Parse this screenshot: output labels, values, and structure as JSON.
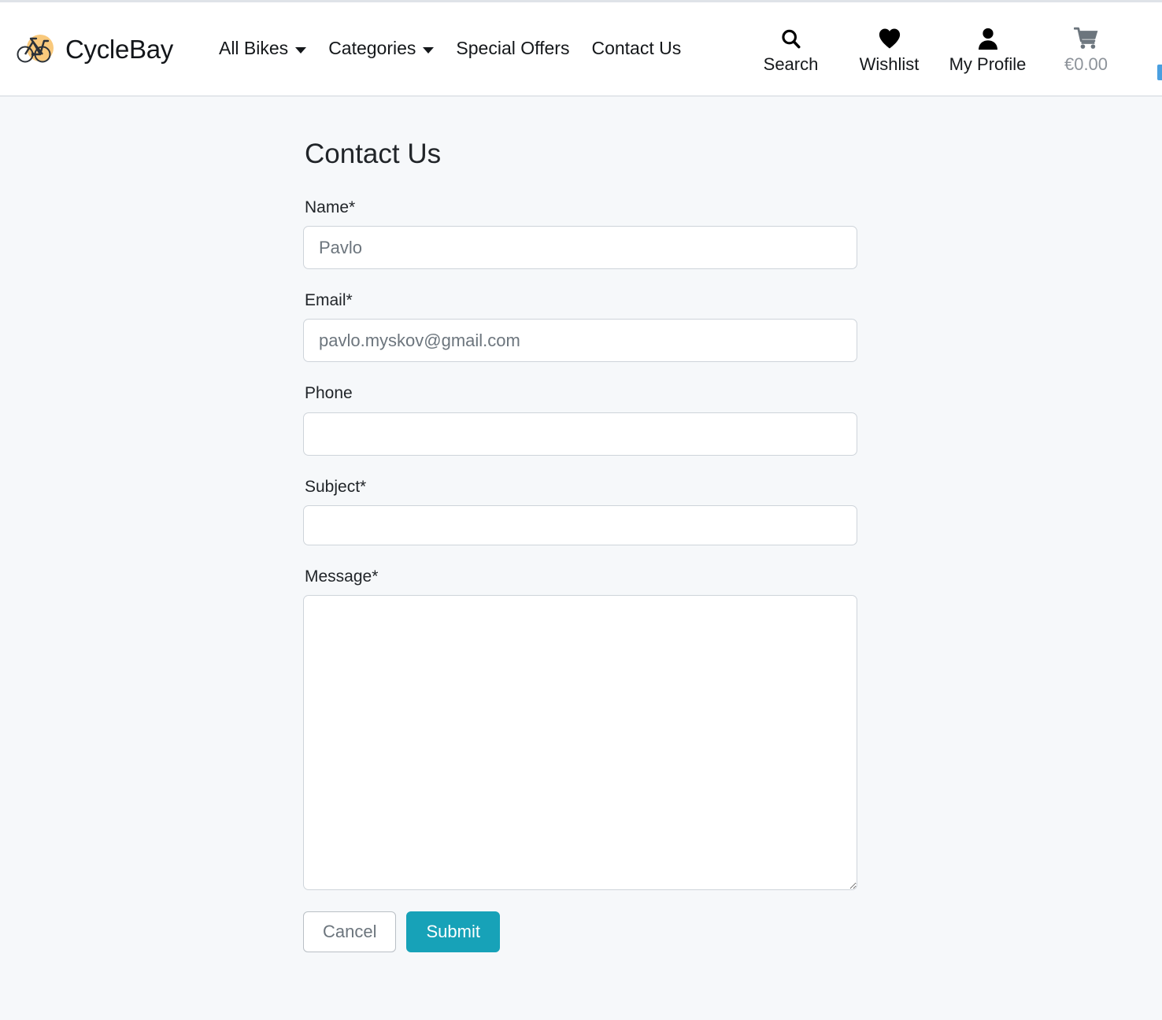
{
  "header": {
    "brand": {
      "name": "CycleBay",
      "icon": "bicycle-logo-icon",
      "accent_color": "#f9c97c"
    },
    "nav": [
      {
        "label": "All Bikes",
        "has_dropdown": true
      },
      {
        "label": "Categories",
        "has_dropdown": true
      },
      {
        "label": "Special Offers",
        "has_dropdown": false
      },
      {
        "label": "Contact Us",
        "has_dropdown": false
      }
    ],
    "actions": [
      {
        "label": "Search",
        "icon": "search-icon"
      },
      {
        "label": "Wishlist",
        "icon": "heart-icon"
      },
      {
        "label": "My Profile",
        "icon": "person-icon"
      },
      {
        "label": "€0.00",
        "icon": "shopping-cart-icon"
      }
    ]
  },
  "main": {
    "title": "Contact Us",
    "fields": [
      {
        "label": "Name*",
        "value": "Pavlo",
        "placeholder": "Pavlo",
        "type": "text"
      },
      {
        "label": "Email*",
        "value": "pavlo.myskov@gmail.com",
        "placeholder": "pavlo.myskov@gmail.com",
        "type": "email"
      },
      {
        "label": "Phone",
        "value": "",
        "placeholder": "",
        "type": "tel"
      },
      {
        "label": "Subject*",
        "value": "",
        "placeholder": "",
        "type": "text"
      },
      {
        "label": "Message*",
        "value": "",
        "placeholder": "",
        "type": "textarea"
      }
    ],
    "buttons": {
      "cancel_label": "Cancel",
      "submit_label": "Submit",
      "submit_color": "#17a2b8"
    }
  }
}
